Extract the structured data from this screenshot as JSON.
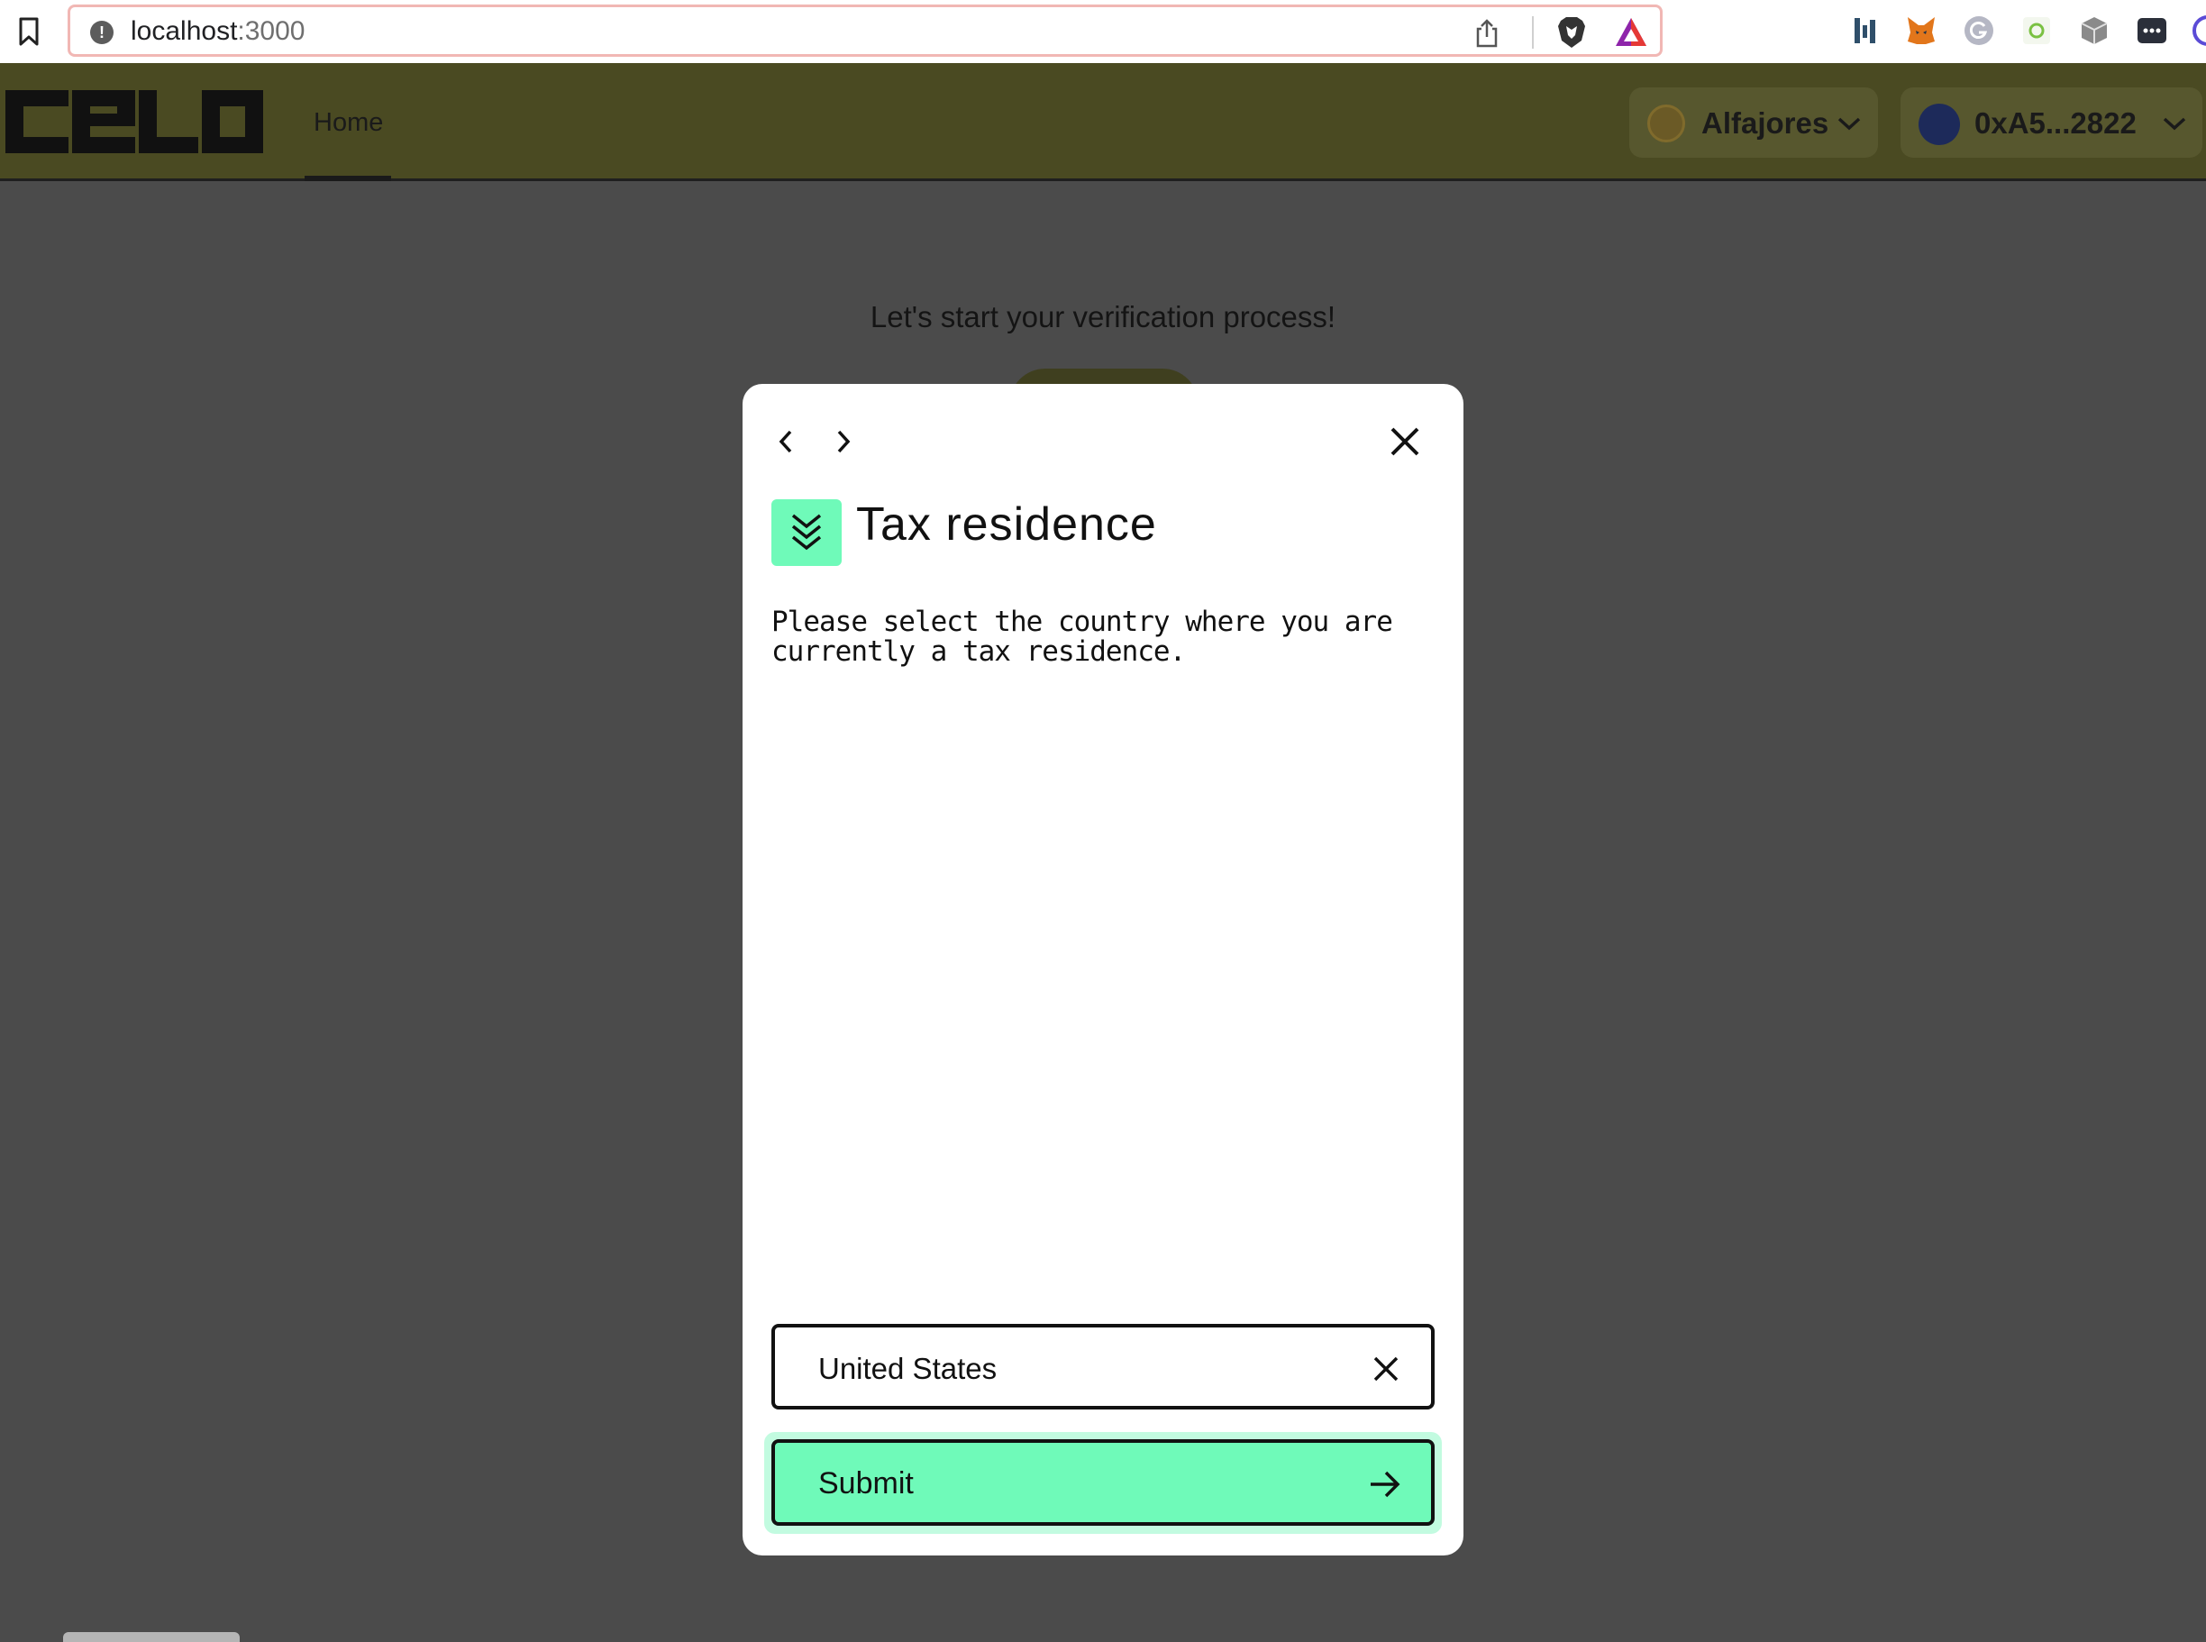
{
  "browser": {
    "url_host": "localhost",
    "url_port": ":3000",
    "extensions": [
      "bookmark-icon",
      "share-icon",
      "brave-shield-icon",
      "bat-rewards-icon",
      "extension-bars-icon",
      "metamask-fox-icon",
      "grammarly-icon",
      "extension-green-icon",
      "cube-icon",
      "more-icon"
    ]
  },
  "header": {
    "logo_text": "celo",
    "nav_home": "Home",
    "network_label": "Alfajores",
    "account_label": "0xA5...2822"
  },
  "page": {
    "verify_text": "Let's start your verification process!"
  },
  "modal": {
    "title": "Tax residence",
    "description": "Please select the country where you are currently a tax residence.",
    "country_value": "United States",
    "submit_label": "Submit"
  },
  "colors": {
    "accent": "#6ffab9",
    "header_bg": "#4a4a22",
    "overlay_bg": "#4b4b4b"
  }
}
